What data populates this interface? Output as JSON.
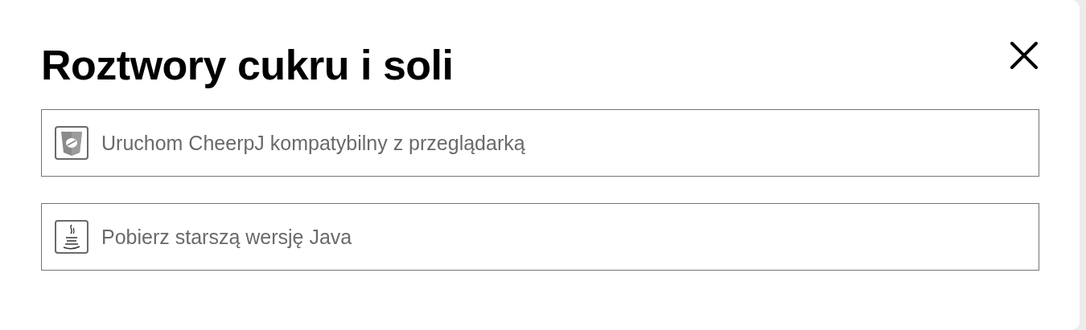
{
  "dialog": {
    "title": "Roztwory cukru i soli"
  },
  "options": [
    {
      "kind": "cheerpj",
      "label": "Uruchom CheerpJ kompatybilny z przeglądarką"
    },
    {
      "kind": "java",
      "label": "Pobierz starszą wersję Java"
    }
  ]
}
